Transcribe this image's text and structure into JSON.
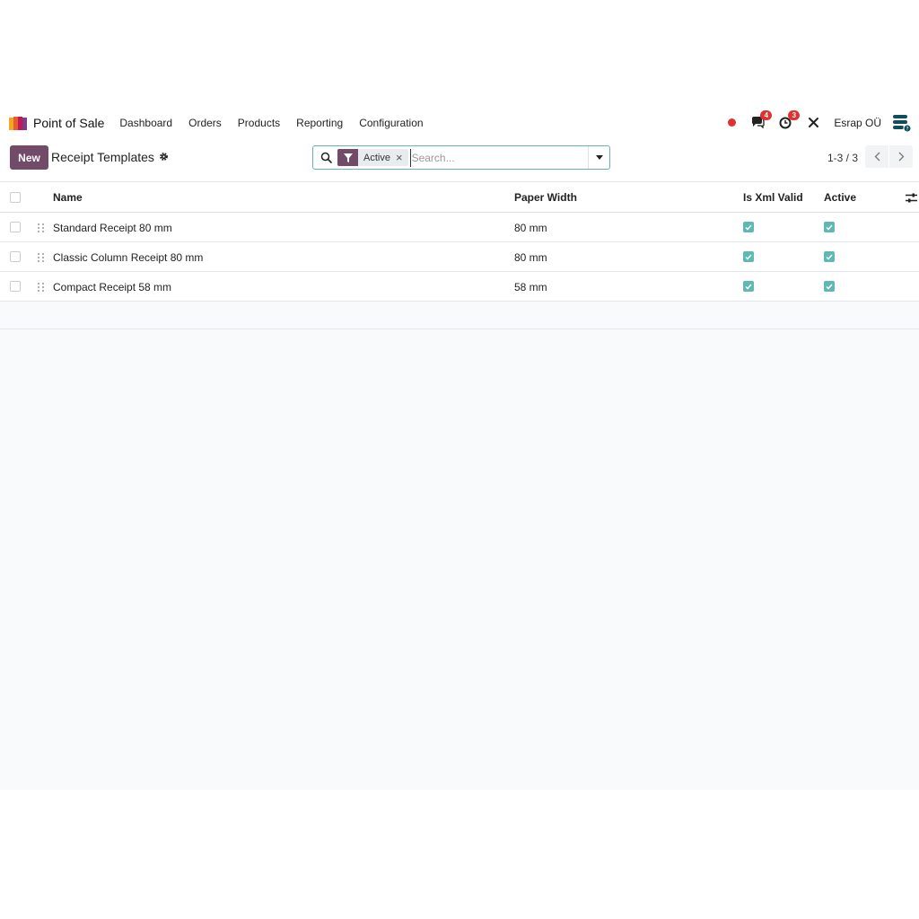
{
  "navbar": {
    "app_name": "Point of Sale",
    "menu": [
      "Dashboard",
      "Orders",
      "Products",
      "Reporting",
      "Configuration"
    ],
    "messages_count": "4",
    "activities_count": "3",
    "company": "Esrap OÜ"
  },
  "control": {
    "new_label": "New",
    "title": "Receipt Templates",
    "facet_label": "Active",
    "search_placeholder": "Search...",
    "pager": "1-3 / 3"
  },
  "table": {
    "columns": [
      "Name",
      "Paper Width",
      "Is Xml Valid",
      "Active"
    ],
    "rows": [
      {
        "name": "Standard Receipt 80 mm",
        "paper_width": "80 mm",
        "is_xml_valid": true,
        "active": true
      },
      {
        "name": "Classic Column Receipt 80 mm",
        "paper_width": "80 mm",
        "is_xml_valid": true,
        "active": true
      },
      {
        "name": "Compact Receipt 58 mm",
        "paper_width": "58 mm",
        "is_xml_valid": true,
        "active": true
      }
    ]
  },
  "colors": {
    "brand": "#714b67",
    "check": "#5fb8b2",
    "badge": "#e0312f"
  }
}
